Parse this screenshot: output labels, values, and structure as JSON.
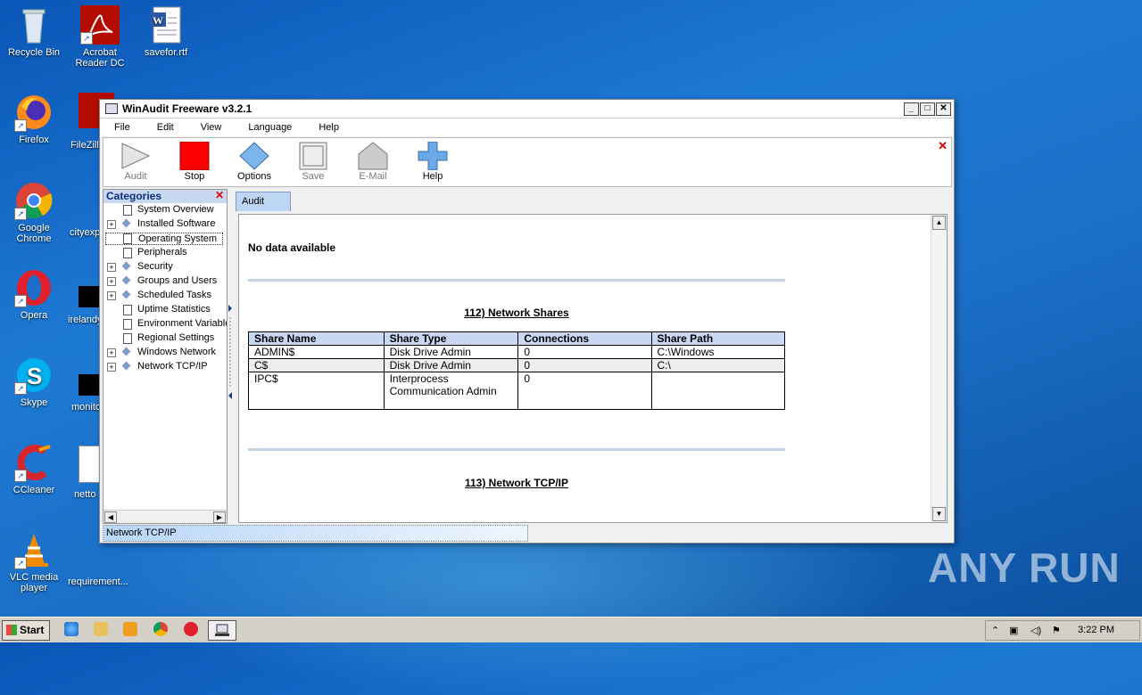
{
  "desktop": {
    "icons": [
      {
        "label": "Recycle Bin"
      },
      {
        "label": "Acrobat Reader DC"
      },
      {
        "label": "savefor.rtf"
      },
      {
        "label": "Firefox"
      },
      {
        "label": "FileZilla"
      },
      {
        "label": "Google Chrome"
      },
      {
        "label": "cityexp"
      },
      {
        "label": "Opera"
      },
      {
        "label": "irelandy"
      },
      {
        "label": "Skype"
      },
      {
        "label": "monito"
      },
      {
        "label": "CCleaner"
      },
      {
        "label": "netto"
      },
      {
        "label": "VLC media player"
      },
      {
        "label": "requirement..."
      }
    ],
    "watermark": "ANY RUN"
  },
  "window": {
    "title": "WinAudit Freeware v3.2.1",
    "menu": [
      "File",
      "Edit",
      "View",
      "Language",
      "Help"
    ],
    "toolbar": {
      "audit": "Audit",
      "stop": "Stop",
      "options": "Options",
      "save": "Save",
      "email": "E-Mail",
      "help": "Help"
    },
    "categories": {
      "header": "Categories",
      "items": [
        {
          "label": "System Overview",
          "expandable": false
        },
        {
          "label": "Installed Software",
          "expandable": true
        },
        {
          "label": "Operating System",
          "expandable": false
        },
        {
          "label": "Peripherals",
          "expandable": false
        },
        {
          "label": "Security",
          "expandable": true
        },
        {
          "label": "Groups and Users",
          "expandable": true
        },
        {
          "label": "Scheduled Tasks",
          "expandable": true
        },
        {
          "label": "Uptime Statistics",
          "expandable": false
        },
        {
          "label": "Environment Variables",
          "expandable": false
        },
        {
          "label": "Regional Settings",
          "expandable": false
        },
        {
          "label": "Windows Network",
          "expandable": true
        },
        {
          "label": "Network TCP/IP",
          "expandable": true
        }
      ]
    },
    "tab": "Audit",
    "report": {
      "no_data": "No data available",
      "section_shares": "112) Network Shares",
      "table": {
        "headers": [
          "Share Name",
          "Share Type",
          "Connections",
          "Share Path"
        ],
        "rows": [
          [
            "ADMIN$",
            "Disk Drive Admin",
            "0",
            "C:\\Windows"
          ],
          [
            "C$",
            "Disk Drive Admin",
            "0",
            "C:\\"
          ],
          [
            "IPC$",
            "Interprocess Communication Admin",
            "0",
            ""
          ]
        ]
      },
      "section_tcpip": "113) Network TCP/IP"
    },
    "status": "Network TCP/IP"
  },
  "taskbar": {
    "start": "Start",
    "clock": "3:22 PM"
  }
}
